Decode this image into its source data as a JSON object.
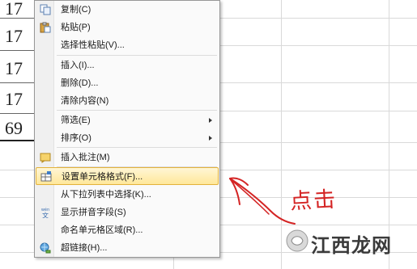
{
  "sheet": {
    "cells": [
      "17",
      "17",
      "17",
      "17",
      "69"
    ]
  },
  "context_menu": {
    "items": [
      {
        "label": "复制(C)",
        "icon": "copy-icon",
        "submenu": false
      },
      {
        "label": "粘贴(P)",
        "icon": "paste-icon",
        "submenu": false
      },
      {
        "label": "选择性粘贴(V)...",
        "icon": "",
        "submenu": false
      },
      {
        "label": "插入(I)...",
        "icon": "",
        "submenu": false
      },
      {
        "label": "删除(D)...",
        "icon": "",
        "submenu": false
      },
      {
        "label": "清除内容(N)",
        "icon": "",
        "submenu": false
      },
      {
        "label": "筛选(E)",
        "icon": "",
        "submenu": true
      },
      {
        "label": "排序(O)",
        "icon": "",
        "submenu": true
      },
      {
        "label": "插入批注(M)",
        "icon": "comment-icon",
        "submenu": false
      },
      {
        "label": "设置单元格格式(F)...",
        "icon": "format-cells-icon",
        "submenu": false,
        "highlighted": true
      },
      {
        "label": "从下拉列表中选择(K)...",
        "icon": "",
        "submenu": false
      },
      {
        "label": "显示拼音字段(S)",
        "icon": "phonetic-icon",
        "submenu": false
      },
      {
        "label": "命名单元格区域(R)...",
        "icon": "",
        "submenu": false
      },
      {
        "label": "超链接(H)...",
        "icon": "hyperlink-icon",
        "submenu": false
      }
    ],
    "phonetic_icon_text": "wén 文"
  },
  "annotation": {
    "text": "点击",
    "color": "#d42424"
  },
  "watermark": {
    "text": "江西龙网"
  },
  "colors": {
    "highlight_fill": "#ffe79a",
    "highlight_border": "#e3b23a",
    "menu_bg": "#fafafa",
    "gridline": "#d9d9d9"
  }
}
